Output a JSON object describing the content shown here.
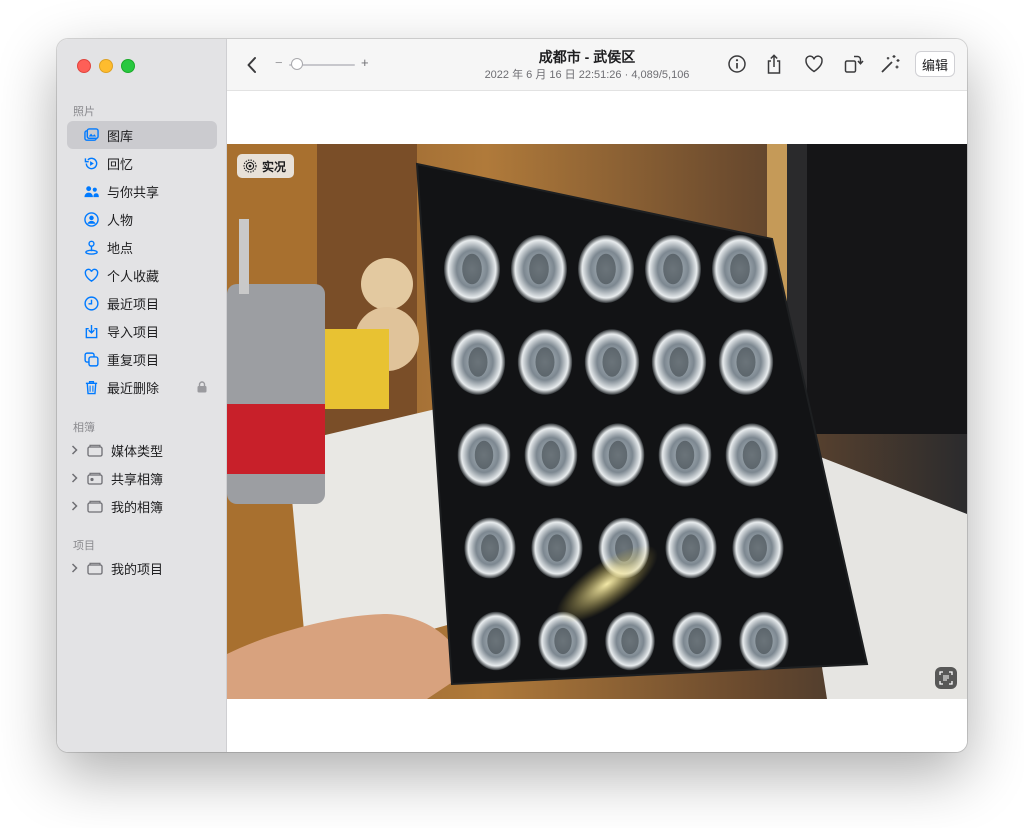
{
  "sidebar": {
    "section_photos": "照片",
    "items": [
      {
        "label": "图库",
        "icon": "photo-library-icon"
      },
      {
        "label": "回忆",
        "icon": "memories-icon"
      },
      {
        "label": "与你共享",
        "icon": "shared-with-you-icon"
      },
      {
        "label": "人物",
        "icon": "people-icon"
      },
      {
        "label": "地点",
        "icon": "places-icon"
      },
      {
        "label": "个人收藏",
        "icon": "heart-icon"
      },
      {
        "label": "最近项目",
        "icon": "clock-icon"
      },
      {
        "label": "导入项目",
        "icon": "import-icon"
      },
      {
        "label": "重复项目",
        "icon": "duplicates-icon"
      },
      {
        "label": "最近删除",
        "icon": "trash-icon"
      }
    ],
    "section_albums": "相簿",
    "albums": [
      "媒体类型",
      "共享相簿",
      "我的相簿"
    ],
    "section_projects": "项目",
    "projects": [
      "我的项目"
    ]
  },
  "toolbar": {
    "title": "成都市 - 武侯区",
    "subtitle": "2022 年 6 月 16 日 22:51:26  ·  4,089/5,106",
    "zoom_minus": "−",
    "zoom_plus": "+",
    "edit_label": "编辑",
    "zoom_level": 0.05
  },
  "photo": {
    "live_label": "实况"
  },
  "colors": {
    "accent": "#007aff",
    "sidebar_bg": "#e3e3e5",
    "active_row": "#cbcbcf"
  }
}
